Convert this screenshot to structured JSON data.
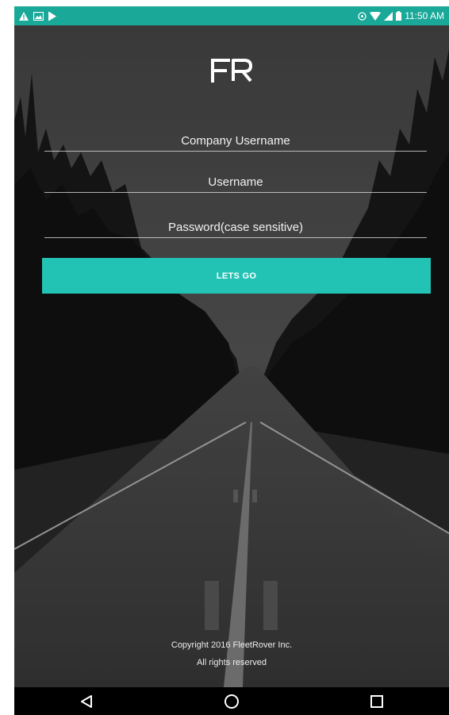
{
  "status_bar": {
    "time": "11:50 AM",
    "left_icons": [
      "warning-icon",
      "image-icon",
      "play-store-icon"
    ],
    "right_icons": [
      "alarm-icon",
      "wifi-icon",
      "signal-icon",
      "battery-icon"
    ]
  },
  "logo": {
    "text": "FR"
  },
  "form": {
    "company_username_placeholder": "Company Username",
    "username_placeholder": "Username",
    "password_placeholder": "Password(case sensitive)",
    "submit_label": "LETS GO"
  },
  "footer": {
    "copyright_line1": "Copyright 2016 FleetRover Inc.",
    "copyright_line2": "All rights reserved"
  },
  "nav_bar": {
    "buttons": [
      "back-icon",
      "home-icon",
      "recents-icon"
    ]
  },
  "colors": {
    "accent": "#22c2b5",
    "status_bar": "#1aa899",
    "nav_bar": "#000000"
  }
}
